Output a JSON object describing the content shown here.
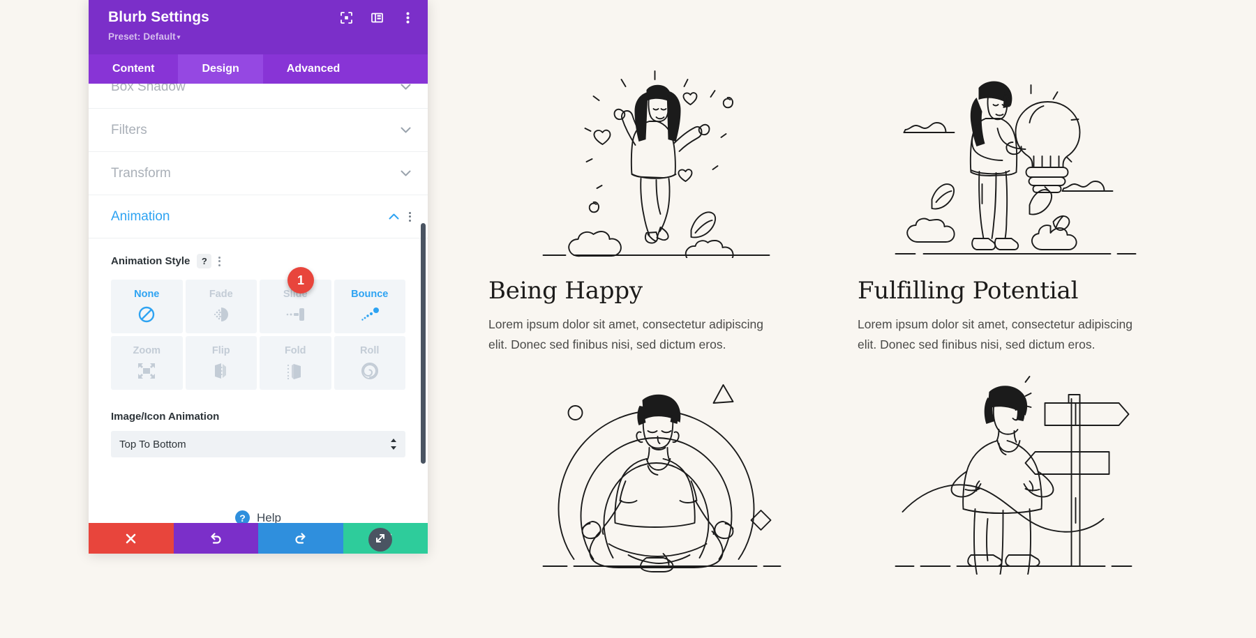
{
  "modal": {
    "title": "Blurb Settings",
    "preset": "Preset: Default",
    "preset_caret": "▾",
    "header_icons": [
      {
        "name": "focus-target-icon",
        "label": "Focus"
      },
      {
        "name": "layout-panel-icon",
        "label": "Layout"
      },
      {
        "name": "more-options-icon",
        "label": "More options"
      }
    ],
    "tabs": [
      {
        "label": "Content",
        "active": false
      },
      {
        "label": "Design",
        "active": true
      },
      {
        "label": "Advanced",
        "active": false
      }
    ],
    "sections": [
      {
        "label": "Box Shadow",
        "open": false
      },
      {
        "label": "Filters",
        "open": false
      },
      {
        "label": "Transform",
        "open": false
      },
      {
        "label": "Animation",
        "open": true
      }
    ],
    "animation": {
      "field_label": "Animation Style",
      "help_glyph": "?",
      "styles": [
        {
          "label": "None",
          "state": "selected"
        },
        {
          "label": "Fade",
          "state": "normal"
        },
        {
          "label": "Slide",
          "state": "normal"
        },
        {
          "label": "Bounce",
          "state": "hovered"
        },
        {
          "label": "Zoom",
          "state": "normal"
        },
        {
          "label": "Flip",
          "state": "normal"
        },
        {
          "label": "Fold",
          "state": "normal"
        },
        {
          "label": "Roll",
          "state": "normal"
        }
      ],
      "badge": "1",
      "image_icon_animation_label": "Image/Icon Animation",
      "image_icon_animation_value": "Top To Bottom"
    },
    "help": {
      "glyph": "?",
      "label": "Help"
    },
    "actions": [
      {
        "name": "cancel-button",
        "glyph": "close-icon",
        "color": "#e8453c"
      },
      {
        "name": "undo-button",
        "glyph": "undo-icon",
        "color": "#7b2fc9"
      },
      {
        "name": "redo-button",
        "glyph": "redo-icon",
        "color": "#2f8fdd"
      },
      {
        "name": "save-button",
        "glyph": "check-icon",
        "color": "#2ecc9b"
      }
    ],
    "colors": {
      "header_purple": "#7b2fc9",
      "tabbar_purple": "#8834d6",
      "tab_active_purple": "#9548e2",
      "accent_blue": "#2ea3f2",
      "badge_red": "#e8453c",
      "save_green": "#2ecc9b"
    }
  },
  "page": {
    "background": "#f9f6f1",
    "blurbs": [
      {
        "illustration": "woman-celebrating-with-hearts-illustration",
        "title": "Being Happy",
        "body": "Lorem ipsum dolor sit amet, consectetur adipiscing elit. Donec sed finibus nisi, sed dictum eros."
      },
      {
        "illustration": "woman-holding-lightbulb-illustration",
        "title": "Fulfilling Potential",
        "body": "Lorem ipsum dolor sit amet, consectetur adipiscing elit. Donec sed finibus nisi, sed dictum eros."
      },
      {
        "illustration": "man-meditating-lotus-illustration",
        "title": "",
        "body": ""
      },
      {
        "illustration": "man-facing-signpost-illustration",
        "title": "",
        "body": ""
      }
    ]
  }
}
